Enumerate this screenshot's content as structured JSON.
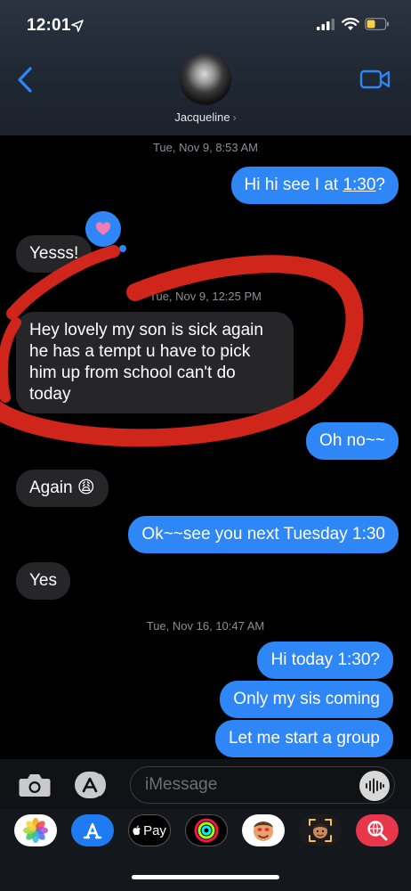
{
  "status_bar": {
    "time": "12:01"
  },
  "contact": {
    "name": "Jacqueline",
    "chevron": "›"
  },
  "thread": {
    "timestamps": [
      {
        "day": "Tue, Nov 9,",
        "time": "8:53 AM"
      },
      {
        "day": "Tue, Nov 9,",
        "time": "12:25 PM"
      },
      {
        "day": "Tue, Nov 16,",
        "time": "10:47 AM"
      }
    ],
    "messages": [
      {
        "from": "me",
        "pre": "Hi hi see I at ",
        "link": "1:30",
        "post": "?"
      },
      {
        "from": "them",
        "text": "Yesss!"
      },
      {
        "from": "them",
        "text": "Hey lovely my son is sick again he has a tempt u have to pick him up from school can't do today"
      },
      {
        "from": "me",
        "text": "Oh no~~"
      },
      {
        "from": "them",
        "text": "Again 😩"
      },
      {
        "from": "me",
        "text": "Ok~~see you next Tuesday 1:30"
      },
      {
        "from": "them",
        "text": "Yes"
      },
      {
        "from": "me",
        "text": "Hi today 1:30?"
      },
      {
        "from": "me",
        "text": "Only my sis coming"
      },
      {
        "from": "me",
        "text": "Let me start a group"
      }
    ],
    "tapback": {
      "icon": "heart-icon",
      "on_message": "Yesss!"
    }
  },
  "composer": {
    "placeholder": "iMessage"
  },
  "app_drawer": {
    "items": [
      {
        "icon": "photos-icon"
      },
      {
        "icon": "app-store-icon"
      },
      {
        "icon": "apple-pay-icon",
        "label": "Pay"
      },
      {
        "icon": "activity-icon"
      },
      {
        "icon": "memoji-stickers-icon"
      },
      {
        "icon": "memoji-icon"
      },
      {
        "icon": "web-search-icon"
      }
    ]
  },
  "colors": {
    "sent_bubble": "#2f86f6",
    "received_bubble": "#262628",
    "accent": "#2f86f6",
    "marker": "#e0281c",
    "timestamp": "#8e8e93"
  }
}
